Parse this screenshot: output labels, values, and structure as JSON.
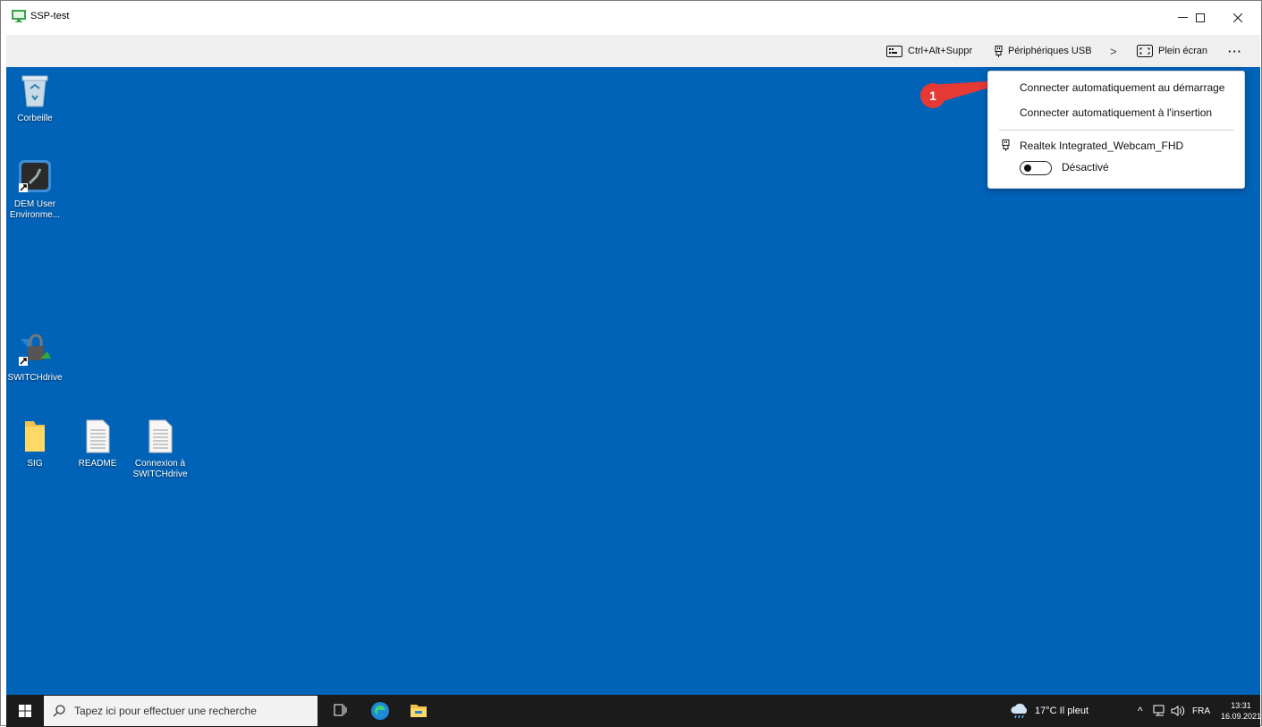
{
  "window": {
    "title": "SSP-test"
  },
  "toolbar": {
    "cad": "Ctrl+Alt+Suppr",
    "usb": "Périphériques USB",
    "fullscreen": "Plein écran",
    "more": "···",
    "chevron": ">"
  },
  "desktop_icons": {
    "recycle": "Corbeille",
    "dem_line1": "DEM User",
    "dem_line2": "Environme...",
    "switchdrive": "SWITCHdrive",
    "sig": "SIG",
    "readme": "README",
    "connexion_line1": "Connexion à",
    "connexion_line2": "SWITCHdrive"
  },
  "usb_menu": {
    "auto_start": "Connecter automatiquement au démarrage",
    "auto_insert": "Connecter automatiquement à l'insertion",
    "device_name": "Realtek Integrated_Webcam_FHD",
    "device_state": "Désactivé"
  },
  "callout": {
    "number": "1",
    "color": "#e53935"
  },
  "taskbar": {
    "search_placeholder": "Tapez ici pour effectuer une recherche",
    "weather": "17°C  Il pleut",
    "lang": "FRA",
    "time": "13:31",
    "date": "16.09.2021"
  },
  "colors": {
    "desktop": "#0063b8",
    "taskbar": "#1b1b1b",
    "toolbar": "#efefef"
  }
}
